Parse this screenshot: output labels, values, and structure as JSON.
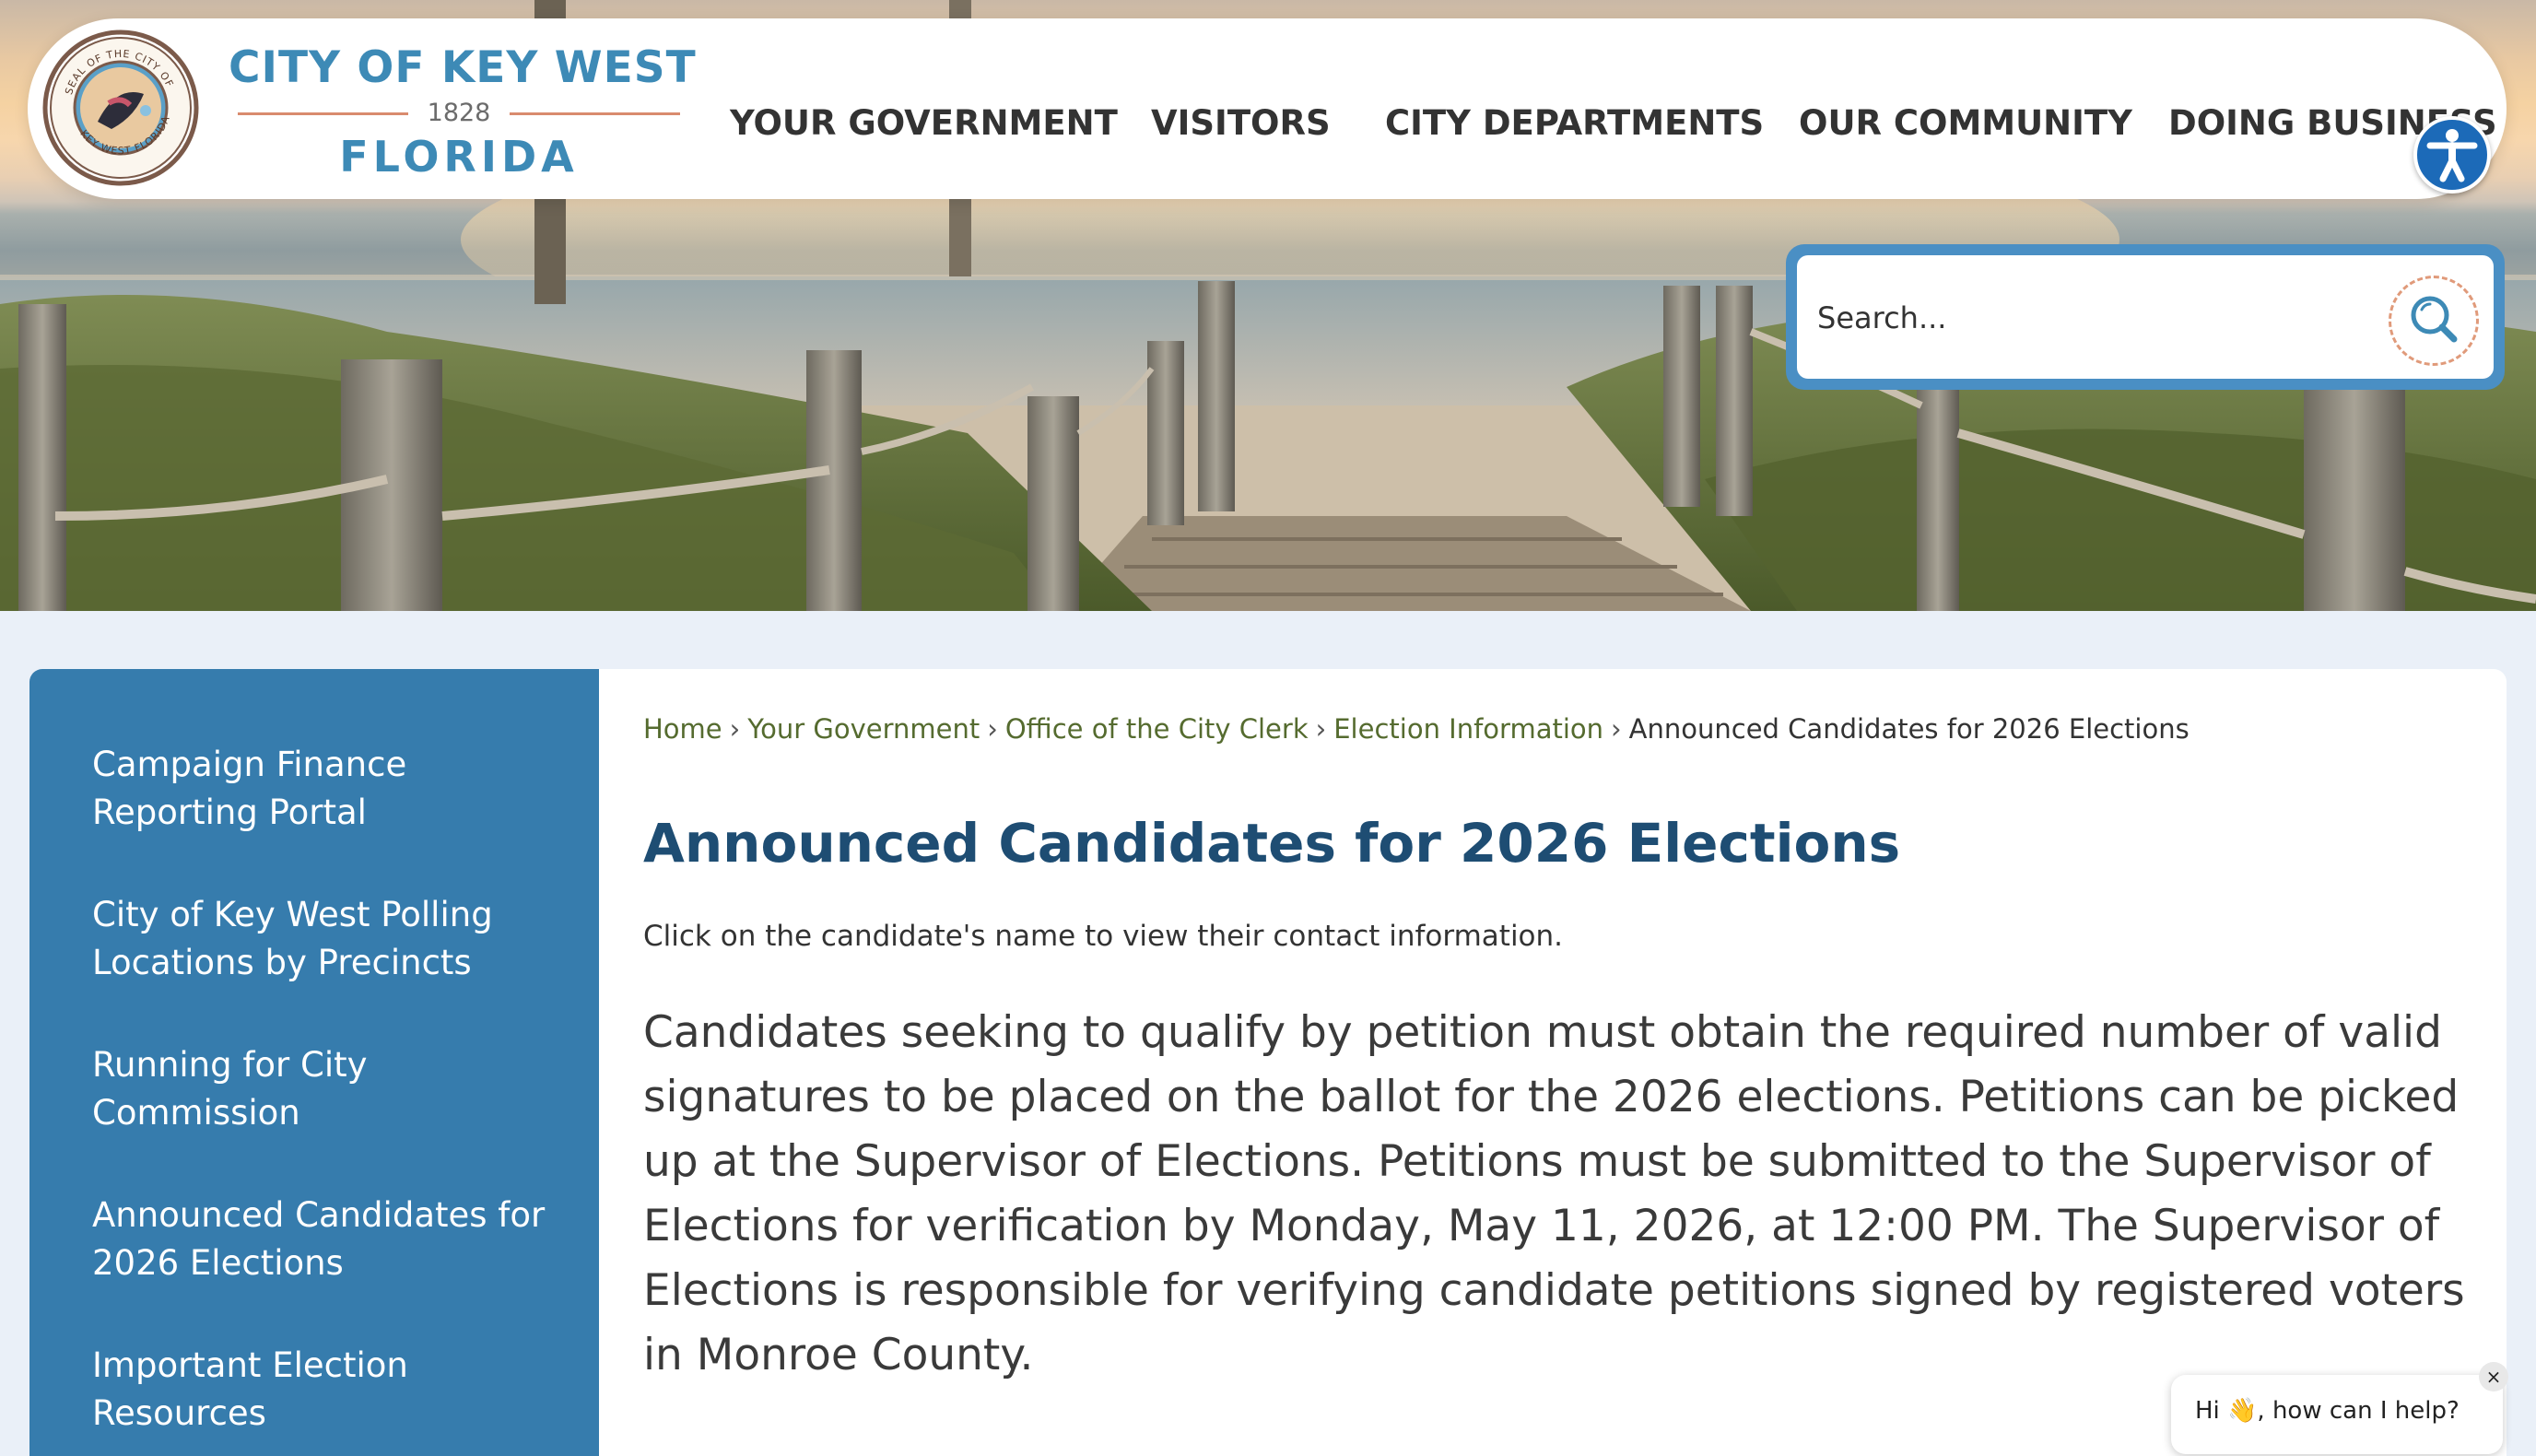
{
  "site": {
    "logo": {
      "city_line": "CITY OF KEY WEST",
      "year": "1828",
      "state_line": "FLORIDA",
      "seal_text_top": "SEAL OF THE CITY OF",
      "seal_text_bottom": "KEY WEST FLORIDA"
    },
    "nav": [
      {
        "label": "YOUR GOVERNMENT"
      },
      {
        "label": "VISITORS"
      },
      {
        "label": "CITY DEPARTMENTS"
      },
      {
        "label": "OUR COMMUNITY"
      },
      {
        "label": "DOING BUSINESS"
      }
    ],
    "accessibility_icon": "accessibility-icon",
    "search": {
      "placeholder": "Search...",
      "icon": "search-icon"
    }
  },
  "sidebar": {
    "items": [
      {
        "label": "Campaign Finance Reporting Portal"
      },
      {
        "label": "City of Key West Polling Locations by Precincts"
      },
      {
        "label": "Running for City Commission"
      },
      {
        "label": "Announced Candidates for 2026 Elections"
      },
      {
        "label": "Important Election Resources"
      }
    ]
  },
  "breadcrumb": {
    "items": [
      {
        "label": "Home"
      },
      {
        "label": "Your Government"
      },
      {
        "label": "Office of the City Clerk"
      },
      {
        "label": "Election Information"
      }
    ],
    "current": "Announced Candidates for 2026 Elections",
    "separator": "›"
  },
  "main": {
    "title": "Announced Candidates for 2026 Elections",
    "intro": "Click on the candidate's name to view their contact information.",
    "body": "Candidates seeking to qualify by petition must obtain the required number of valid signatures to be placed on the ballot for the 2026 elections.  Petitions can be picked up at the Supervisor of Elections.  Petitions must be submitted to the Supervisor of Elections for verification by Monday, May 11, 2026, at 12:00 PM.  The Supervisor of Elections is responsible for verifying candidate petitions signed by registered voters in Monroe County."
  },
  "chat": {
    "text": "Hi 👋, how can I help?",
    "close": "×"
  },
  "colors": {
    "brand_blue": "#3d8ab6",
    "sidebar_blue": "#367cad",
    "title_navy": "#1e4d73",
    "breadcrumb_link": "#556b2f",
    "accent_coral": "#d98b6e",
    "accessibility_blue": "#1c6ab8"
  }
}
